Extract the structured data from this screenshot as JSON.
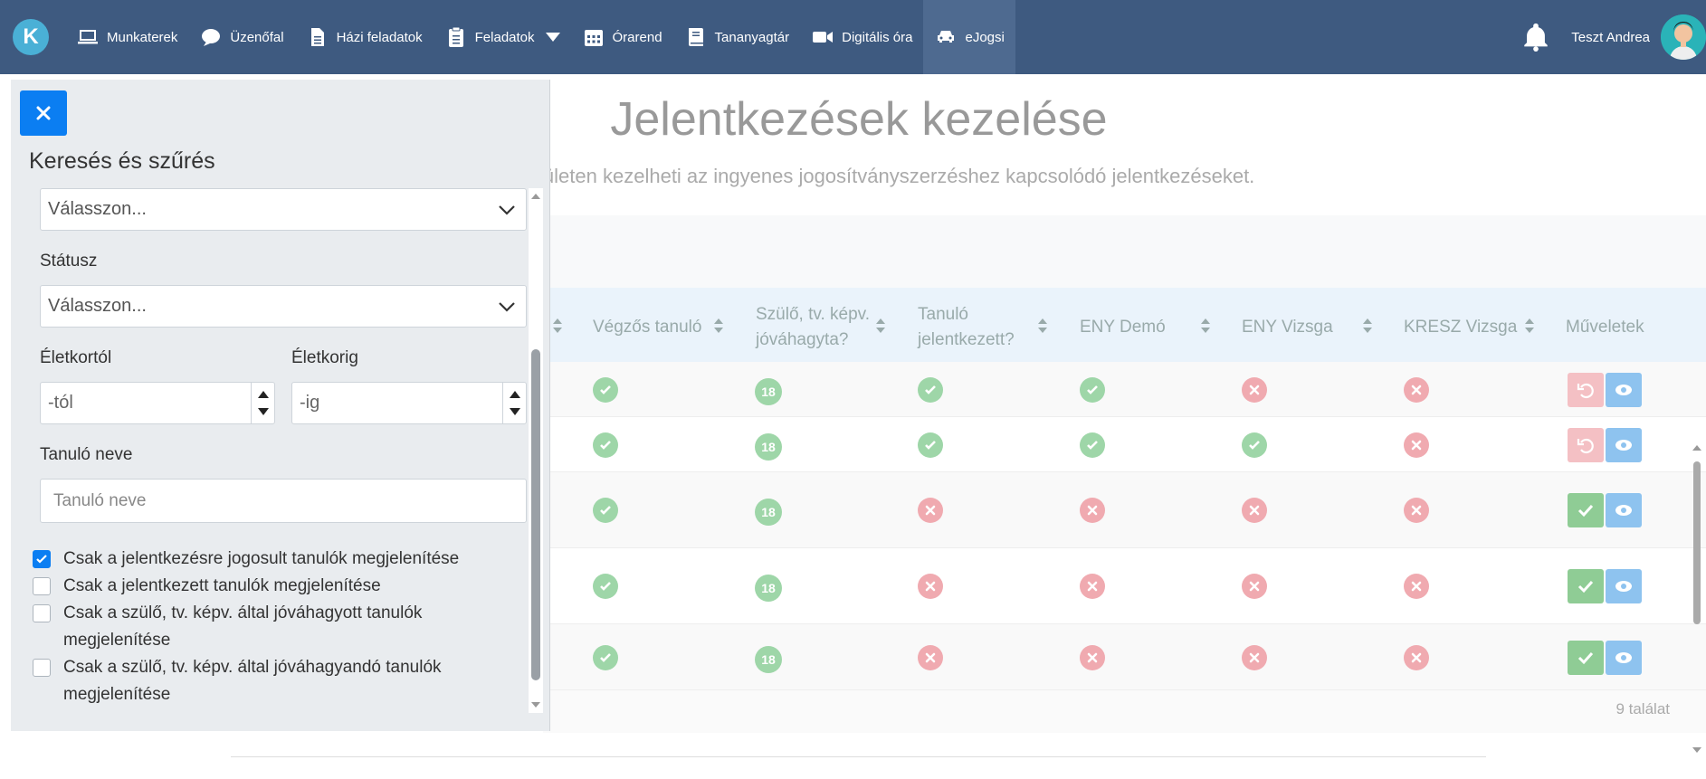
{
  "navbar": {
    "logo_letter": "K",
    "items": [
      {
        "label": "Munkaterek",
        "icon": "laptop-icon"
      },
      {
        "label": "Üzenőfal",
        "icon": "chat-icon"
      },
      {
        "label": "Házi feladatok",
        "icon": "document-icon"
      },
      {
        "label": "Feladatok",
        "icon": "clipboard-icon"
      },
      {
        "label": "Órarend",
        "icon": "calendar-icon"
      },
      {
        "label": "Tananyagtár",
        "icon": "book-icon"
      },
      {
        "label": "Digitális óra",
        "icon": "video-camera-icon"
      },
      {
        "label": "eJogsi",
        "icon": "car-icon"
      }
    ],
    "user_name": "Teszt Andrea"
  },
  "page": {
    "title": "Jelentkezések kezelése",
    "subtitle": "n a felületen kezelheti az ingyenes jogosítványszerzéshez kapcsolódó jelentkezéseket."
  },
  "table": {
    "headers": [
      {
        "label": "Végzős tanuló"
      },
      {
        "label": "Szülő, tv. képv. jóváhagyta?"
      },
      {
        "label": "Tanuló jelentkezett?"
      },
      {
        "label": "ENY Demó"
      },
      {
        "label": "ENY Vizsga"
      },
      {
        "label": "KRESZ Vizsga"
      },
      {
        "label": "Műveletek"
      }
    ],
    "age_badge": "18",
    "rows": [
      {
        "vegzos": true,
        "tanulo": true,
        "demo": true,
        "vizsga": false,
        "kresz": false,
        "action": "undo"
      },
      {
        "vegzos": true,
        "tanulo": true,
        "demo": true,
        "vizsga": true,
        "kresz": false,
        "action": "undo"
      },
      {
        "vegzos": true,
        "tanulo": false,
        "demo": false,
        "vizsga": false,
        "kresz": false,
        "action": "check"
      },
      {
        "vegzos": true,
        "tanulo": false,
        "demo": false,
        "vizsga": false,
        "kresz": false,
        "action": "check"
      },
      {
        "vegzos": true,
        "tanulo": false,
        "demo": false,
        "vizsga": false,
        "kresz": false,
        "action": "check"
      }
    ],
    "results_text": "9 találat"
  },
  "filter": {
    "title": "Keresés és szűrés",
    "first_select": "Válasszon...",
    "status_label": "Státusz",
    "status_select": "Válasszon...",
    "age_from_label": "Életkortól",
    "age_to_label": "Életkorig",
    "age_from_placeholder": "-tól",
    "age_to_placeholder": "-ig",
    "name_label": "Tanuló neve",
    "name_placeholder": "Tanuló neve",
    "checkboxes": [
      {
        "label": "Csak a jelentkezésre jogosult tanulók megjelenítése",
        "checked": true
      },
      {
        "label": "Csak a jelentkezett tanulók megjelenítése",
        "checked": false
      },
      {
        "label": "Csak a szülő, tv. képv. által jóváhagyott tanulók megjelenítése",
        "checked": false
      },
      {
        "label": "Csak a szülő, tv. képv. által jóváhagyandó tanulók megjelenítése",
        "checked": false
      }
    ]
  }
}
